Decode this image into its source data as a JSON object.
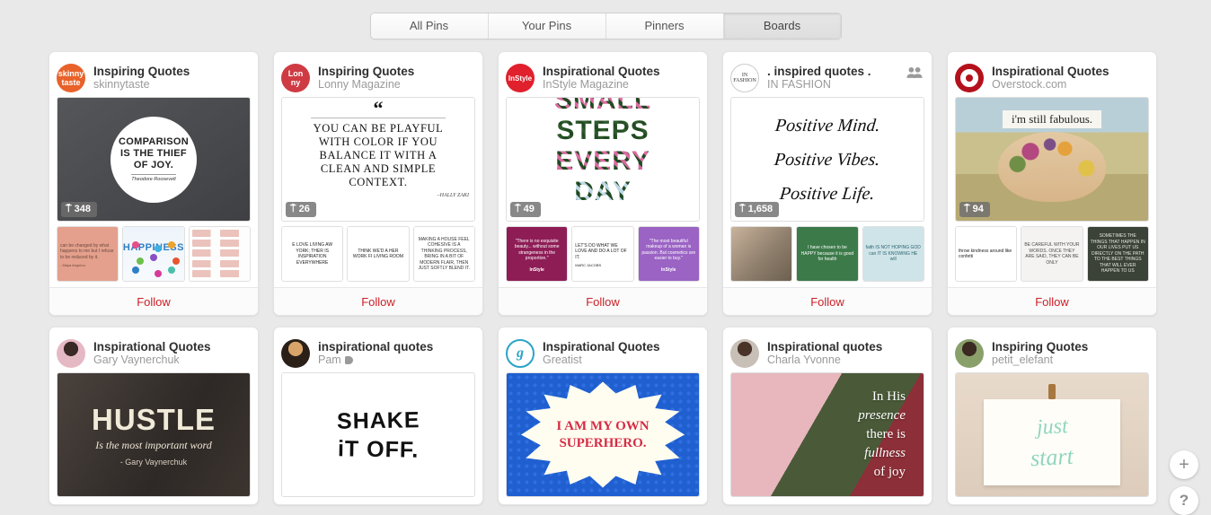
{
  "tabs": [
    {
      "label": "All Pins",
      "active": false
    },
    {
      "label": "Your Pins",
      "active": false
    },
    {
      "label": "Pinners",
      "active": false
    },
    {
      "label": "Boards",
      "active": true
    }
  ],
  "follow_label": "Follow",
  "accent_color": "#cb2027",
  "fab": {
    "add": "+",
    "help": "?"
  },
  "boards": [
    {
      "title": "Inspiring Quotes",
      "user": "skinnytaste",
      "pins": "348",
      "collaborators": false,
      "avatar": {
        "type": "logo",
        "text": "skinny taste",
        "bg": "#e8622a",
        "fg": "#ffffff"
      },
      "hero": {
        "style": "dark-circle-quote",
        "lines": [
          "COMPARISON",
          "IS THE THIEF",
          "OF JOY."
        ],
        "attribution": "Theodore Roosevelt",
        "bg": "#4a4a4a"
      },
      "thumbs": [
        {
          "bg": "#e4a08c",
          "text": "can be changed by what happens to me but I refuse to be reduced by it.",
          "attr": "- Maya Angelou",
          "color": "#6b4a3f",
          "align": "left"
        },
        {
          "bg": "#f2f6fb",
          "text": "HAPPINESS",
          "color": "#2f7fc4",
          "align": "center",
          "style": "diagram"
        },
        {
          "bg": "#fdfdfd",
          "text": "",
          "color": "#c06a5a",
          "align": "left",
          "style": "list"
        }
      ]
    },
    {
      "title": "Inspiring Quotes",
      "user": "Lonny Magazine",
      "pins": "26",
      "collaborators": false,
      "avatar": {
        "type": "logo",
        "text": "Lon ny",
        "bg": "#cf3b43",
        "fg": "#ffffff"
      },
      "hero": {
        "style": "serif-quote",
        "quote_mark": "“",
        "lines": [
          "YOU CAN BE PLAYFUL",
          "WITH COLOR IF YOU",
          "BALANCE IT WITH A",
          "CLEAN AND SIMPLE",
          "CONTEXT."
        ],
        "attribution": "–HALLY ZAKI",
        "bg": "#ffffff"
      },
      "thumbs": [
        {
          "bg": "#ffffff",
          "text": "E LOVE LIVING AW YORK; THER IS INSPIRATION EVERYWHERE",
          "color": "#222222",
          "align": "center"
        },
        {
          "bg": "#ffffff",
          "text": "THINK WE'D A HER WORK FI LIVING ROOM",
          "color": "#222222",
          "align": "center"
        },
        {
          "bg": "#ffffff",
          "text": "MAKING A HOUSE FEEL COHESIVE IS A THINKING PROCESS, BRING IN A BIT OF MODERN FLAIR, THEN JUST SOFTLY BLEND IT.",
          "color": "#333333",
          "align": "center"
        }
      ]
    },
    {
      "title": "Inspirational Quotes",
      "user": "InStyle Magazine",
      "pins": "49",
      "collaborators": false,
      "avatar": {
        "type": "logo",
        "text": "InStyle",
        "bg": "#e0202c",
        "fg": "#ffffff"
      },
      "hero": {
        "style": "floral-type",
        "lines": [
          "SMALL",
          "STEPS",
          "EVERY",
          "DAY"
        ],
        "bg": "#ffffff"
      },
      "thumbs": [
        {
          "bg": "#8e1d56",
          "text": "\"There is no exquisite beauty... without some strangeness in the proportion.\"",
          "color": "#ffffff",
          "align": "center",
          "brand": "InStyle"
        },
        {
          "bg": "#ffffff",
          "text": "LET'S DO WHAT WE LOVE AND DO A LOT OF IT.",
          "attr": "MARC JACOBS",
          "color": "#222222",
          "align": "left"
        },
        {
          "bg": "#9a63c4",
          "text": "\"The most beautiful makeup of a woman is passion. But cosmetics are easier to buy.\"",
          "color": "#ffffff",
          "align": "center",
          "brand": "InStyle"
        }
      ]
    },
    {
      "title": ". inspired quotes .",
      "user": "IN FASHION",
      "pins": "1,658",
      "collaborators": true,
      "avatar": {
        "type": "logo",
        "text": "IN FASHION",
        "bg": "#ffffff",
        "fg": "#333333"
      },
      "hero": {
        "style": "handwriting",
        "lines": [
          "Positive Mind.",
          "Positive Vibes.",
          "Positive Life."
        ],
        "bg": "#ffffff"
      },
      "thumbs": [
        {
          "bg": "#d8c9bd",
          "text": "",
          "color": "#555555",
          "align": "center",
          "style": "photo-floral"
        },
        {
          "bg": "#3c7a4a",
          "text": "I have chosen to be HAPPY because it is good for health",
          "color": "#ffffff",
          "align": "center"
        },
        {
          "bg": "#cfe4e8",
          "text": "faith IS NOT HOPING GOD can IT IS KNOWING HE will",
          "color": "#2a6472",
          "align": "center"
        }
      ]
    },
    {
      "title": "Inspirational Quotes",
      "user": "Overstock.com",
      "pins": "94",
      "collaborators": false,
      "avatar": {
        "type": "logo",
        "text": "O",
        "bg": "#b4111c",
        "fg": "#ffffff"
      },
      "hero": {
        "style": "photo-quote",
        "lines": [
          "i'm still fabulous."
        ],
        "bg": "#d6c9a8"
      },
      "thumbs": [
        {
          "bg": "#ffffff",
          "text": "throw kindness around like confetti",
          "color": "#1a1a1a",
          "align": "left"
        },
        {
          "bg": "#f4f3f1",
          "text": "BE CAREFUL WITH YOUR WORDS. ONCE THEY ARE SAID, THEY CAN BE ONLY",
          "color": "#4a4a4a",
          "align": "center"
        },
        {
          "bg": "#3b4238",
          "text": "SOMETIMES THE THINGS THAT HAPPEN IN OUR LIVES PUT US DIRECTLY ON THE PATH TO THE BEST THINGS THAT WILL EVER HAPPEN TO US",
          "color": "#e8e8e0",
          "align": "center"
        }
      ]
    },
    {
      "title": "Inspirational Quotes",
      "user": "Gary Vaynerchuk",
      "pins": "",
      "collaborators": false,
      "avatar": {
        "type": "photo",
        "bg": "#e5b9c4",
        "fg": "#3a2a26"
      },
      "hero": {
        "style": "dark-photo-type",
        "lines": [
          "HUSTLE"
        ],
        "sub": "Is the most important word",
        "attribution": "- Gary Vaynerchuk",
        "bg": "#3a3330"
      },
      "thumbs": []
    },
    {
      "title": "inspirational quotes",
      "user": "Pam",
      "user_badge": true,
      "pins": "",
      "collaborators": false,
      "avatar": {
        "type": "photo",
        "bg": "#2b2018",
        "fg": "#d8a46a"
      },
      "hero": {
        "style": "brush-type",
        "lines": [
          "SHAKE",
          "iT OFF."
        ],
        "bg": "#ffffff"
      },
      "thumbs": []
    },
    {
      "title": "Inspirational Quotes",
      "user": "Greatist",
      "pins": "",
      "collaborators": false,
      "avatar": {
        "type": "logo",
        "text": "g",
        "bg": "#ffffff",
        "fg": "#2aa3c7"
      },
      "hero": {
        "style": "comic-burst",
        "lines": [
          "I AM MY OWN",
          "SUPERHERO."
        ],
        "bg": "#1f5fd0"
      },
      "thumbs": []
    },
    {
      "title": "Inspirational quotes",
      "user": "Charla Yvonne",
      "pins": "",
      "collaborators": false,
      "avatar": {
        "type": "photo",
        "bg": "#c8bfb6",
        "fg": "#4a342a"
      },
      "hero": {
        "style": "floral-photo-quote",
        "lines": [
          "In His",
          "presence",
          "there is",
          "fullness",
          "of joy"
        ],
        "bg": "#b98a8a"
      },
      "thumbs": []
    },
    {
      "title": "Inspiring Quotes",
      "user": "petit_elefant",
      "pins": "",
      "collaborators": false,
      "avatar": {
        "type": "photo",
        "bg": "#8aa06b",
        "fg": "#3a2a22"
      },
      "hero": {
        "style": "card-on-wall",
        "lines": [
          "just",
          "start"
        ],
        "bg": "#e3d6ca"
      },
      "thumbs": []
    }
  ]
}
